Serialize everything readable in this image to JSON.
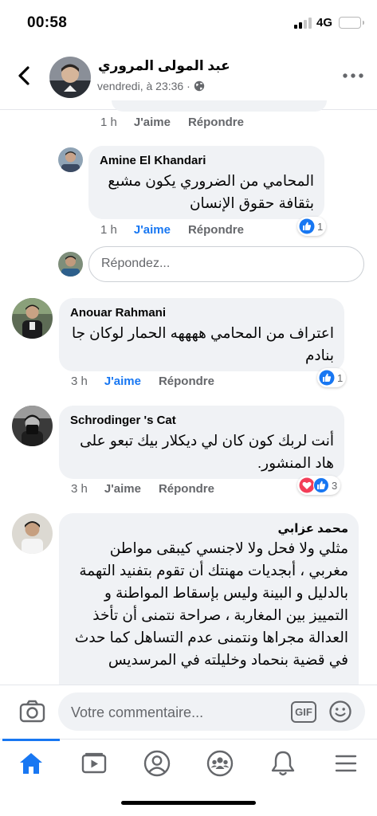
{
  "status_bar": {
    "time": "00:58",
    "network": "4G"
  },
  "header": {
    "author": "عبد المولى المروري",
    "timestamp": "vendredi, à 23:36 ·"
  },
  "comments": [
    {
      "time": "1 h",
      "like_label": "J'aime",
      "reply_label": "Répondre"
    },
    {
      "author": "Amine El Khandari",
      "text": "المحامي من الضروري يكون مشبع بثقافة حقوق الإنسان",
      "time": "1 h",
      "like_label": "J'aime",
      "reply_label": "Répondre",
      "reaction_count": "1"
    },
    {
      "author": "Anouar Rahmani",
      "text": "اعتراف من المحامي ههههه الحمار لوكان جا بنادم",
      "time": "3 h",
      "like_label": "J'aime",
      "reply_label": "Répondre",
      "reaction_count": "1"
    },
    {
      "author": "Schrodinger 's Cat",
      "text": "أنت لربك كون كان لي ديكلار بيك تبعو على هاد المنشور.",
      "time": "3 h",
      "like_label": "J'aime",
      "reply_label": "Répondre",
      "reaction_count": "3"
    },
    {
      "author": "محمد عزابي",
      "text": "مثلي ولا فحل ولا لاجنسي كيبقى مواطن مغربي ، أبجديات مهنتك أن تقوم بتفنيد التهمة بالدليل و البينة وليس بإسقاط المواطنة و التمييز بين المغاربة ، صراحة نتمنى أن تأخذ العدالة مجراها ونتمنى عدم التساهل كما حدث في قضية بنحماد وخليلته في المرسديس"
    }
  ],
  "reply_box": {
    "placeholder": "Répondez..."
  },
  "comment_bar": {
    "placeholder": "Votre commentaire...",
    "gif_label": "GIF"
  },
  "tabs": [
    {
      "name": "home",
      "active": true
    },
    {
      "name": "watch",
      "active": false
    },
    {
      "name": "profile",
      "active": false
    },
    {
      "name": "groups",
      "active": false
    },
    {
      "name": "notifications",
      "active": false
    },
    {
      "name": "menu",
      "active": false
    }
  ],
  "colors": {
    "accent": "#1877f2",
    "bubble": "#f0f2f5",
    "muted_text": "#65676b",
    "love": "#f33e58"
  }
}
